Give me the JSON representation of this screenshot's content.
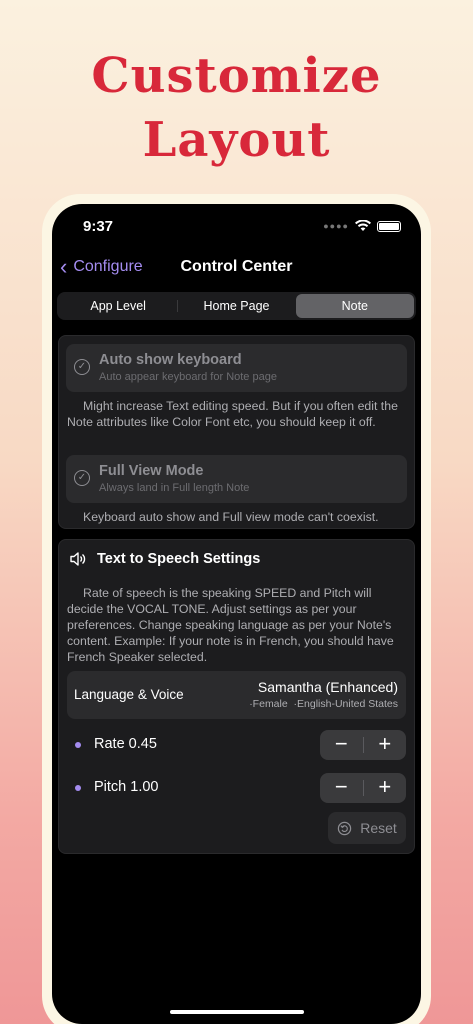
{
  "headline": {
    "line1": "Customize",
    "line2": "Layout"
  },
  "status": {
    "time": "9:37"
  },
  "nav": {
    "back_label": "Configure",
    "title": "Control Center"
  },
  "tabs": [
    {
      "label": "App Level",
      "active": false
    },
    {
      "label": "Home Page",
      "active": false
    },
    {
      "label": "Note",
      "active": true
    }
  ],
  "settings": {
    "auto_show": {
      "title": "Auto show keyboard",
      "subtitle": "Auto appear keyboard for Note page"
    },
    "auto_show_note": "Might increase Text editing speed. But if you often edit the Note attributes like Color Font etc, you should keep it off.",
    "full_view": {
      "title": "Full View Mode",
      "subtitle": "Always land in Full length Note"
    },
    "full_view_note": "Keyboard auto show and Full view mode can't coexist."
  },
  "tts": {
    "title": "Text to Speech Settings",
    "description": "Rate of speech is the speaking SPEED and Pitch will decide the VOCAL TONE. Adjust settings as per your preferences. Change speaking language as per your Note's content. Example: If your note is in French, you should have French Speaker selected.",
    "language_label": "Language & Voice",
    "voice_name": "Samantha (Enhanced)",
    "voice_meta": "·Female  ·English-United States",
    "rate_label": "Rate 0.45",
    "pitch_label": "Pitch 1.00",
    "minus": "−",
    "plus": "+",
    "reset_label": "Reset"
  },
  "colors": {
    "accent": "#a48cf0",
    "headline": "#d8283a"
  }
}
